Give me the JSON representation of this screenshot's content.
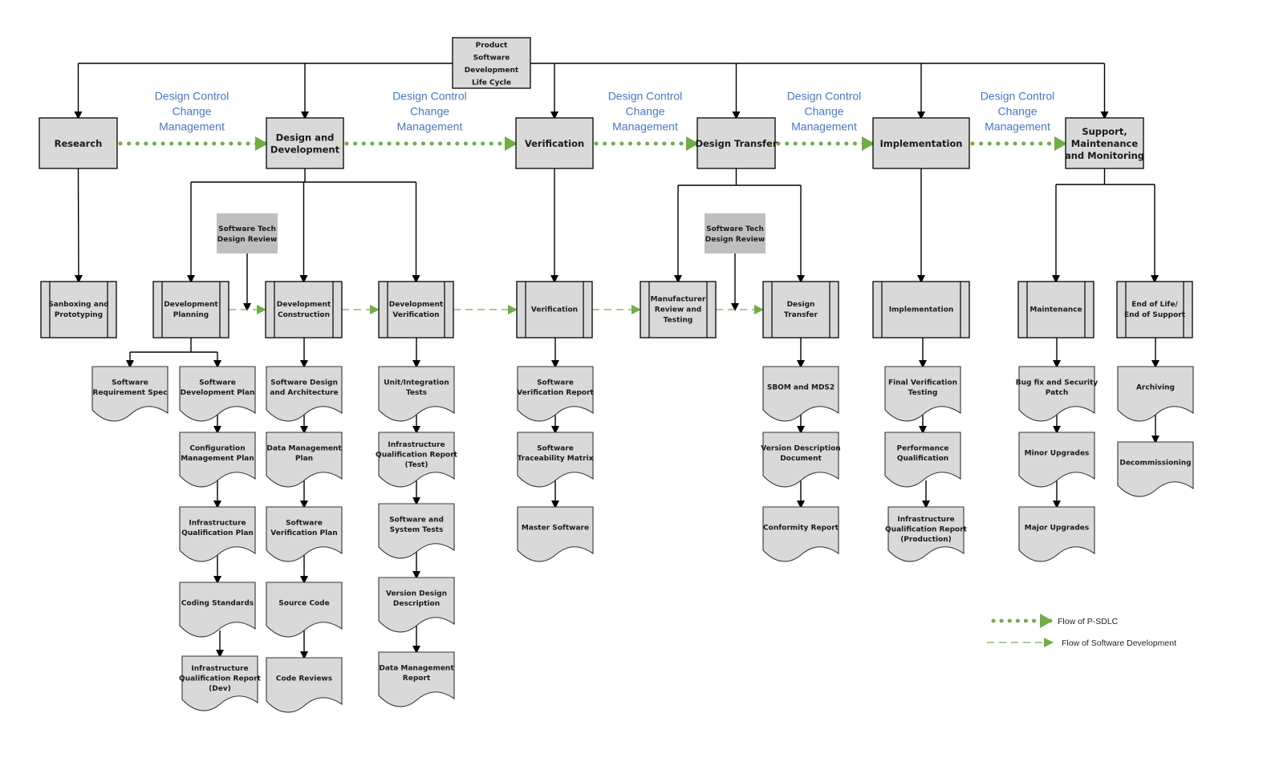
{
  "title": "Product Software Development Life Cycle",
  "colors": {
    "box_fill": "#d9d9d9",
    "review_fill": "#bfbfbf",
    "flow_green": "#70ad47",
    "annotation_blue": "#4a76c8",
    "line": "#000000"
  },
  "root": {
    "id": "root",
    "lines": [
      "Product",
      "Software",
      "Development",
      "Life Cycle"
    ]
  },
  "phases": [
    {
      "id": "research",
      "lines": [
        "Research"
      ]
    },
    {
      "id": "design-dev",
      "lines": [
        "Design and",
        "Development"
      ]
    },
    {
      "id": "verification",
      "lines": [
        "Verification"
      ]
    },
    {
      "id": "design-transfer",
      "lines": [
        "Design Transfer"
      ]
    },
    {
      "id": "implementation",
      "lines": [
        "Implementation"
      ]
    },
    {
      "id": "support",
      "lines": [
        "Support,",
        "Maintenance",
        "and Monitoring"
      ]
    }
  ],
  "phase_transition_label": [
    "Design Control",
    "Change",
    "Management"
  ],
  "review_boxes": [
    {
      "id": "review-1",
      "lines": [
        "Software Tech",
        "Design Review"
      ]
    },
    {
      "id": "review-2",
      "lines": [
        "Software Tech",
        "Design Review"
      ]
    }
  ],
  "subprocesses": [
    {
      "id": "sandboxing",
      "lines": [
        "Sanboxing and",
        "Prototyping"
      ]
    },
    {
      "id": "dev-planning",
      "lines": [
        "Development",
        "Planning"
      ]
    },
    {
      "id": "dev-construction",
      "lines": [
        "Development",
        "Construction"
      ]
    },
    {
      "id": "dev-verification",
      "lines": [
        "Development",
        "Verification"
      ]
    },
    {
      "id": "verification-sub",
      "lines": [
        "Verification"
      ]
    },
    {
      "id": "manufacturer-review",
      "lines": [
        "Manufacturer",
        "Review and",
        "Testing"
      ]
    },
    {
      "id": "design-transfer-sub",
      "lines": [
        "Design",
        "Transfer"
      ]
    },
    {
      "id": "implementation-sub",
      "lines": [
        "Implementation"
      ]
    },
    {
      "id": "maintenance",
      "lines": [
        "Maintenance"
      ]
    },
    {
      "id": "end-of-life",
      "lines": [
        "End of Life/",
        "End of Support"
      ]
    }
  ],
  "documents": [
    {
      "id": "srs",
      "lines": [
        "Software",
        "Requirement Spec"
      ]
    },
    {
      "id": "sdp",
      "lines": [
        "Software",
        "Development Plan"
      ]
    },
    {
      "id": "cmp",
      "lines": [
        "Configuration",
        "Management Plan"
      ]
    },
    {
      "id": "iqp",
      "lines": [
        "Infrastructure",
        "Qualification Plan"
      ]
    },
    {
      "id": "coding-standards",
      "lines": [
        "Coding Standards"
      ]
    },
    {
      "id": "iqr-dev",
      "lines": [
        "Infrastructure",
        "Qualification Report",
        "(Dev)"
      ]
    },
    {
      "id": "sda",
      "lines": [
        "Software Design",
        "and Architecture"
      ]
    },
    {
      "id": "dmp",
      "lines": [
        "Data Management",
        "Plan"
      ]
    },
    {
      "id": "svp",
      "lines": [
        "Software",
        "Verification Plan"
      ]
    },
    {
      "id": "source-code",
      "lines": [
        "Source Code"
      ]
    },
    {
      "id": "code-reviews",
      "lines": [
        "Code Reviews"
      ]
    },
    {
      "id": "unit-tests",
      "lines": [
        "Unit/Integration",
        "Tests"
      ]
    },
    {
      "id": "iqr-test",
      "lines": [
        "Infrastructure",
        "Qualification Report",
        "(Test)"
      ]
    },
    {
      "id": "system-tests",
      "lines": [
        "Software and",
        "System Tests"
      ]
    },
    {
      "id": "vdd-design",
      "lines": [
        "Version Design",
        "Description"
      ]
    },
    {
      "id": "dmr",
      "lines": [
        "Data Management",
        "Report"
      ]
    },
    {
      "id": "svr",
      "lines": [
        "Software",
        "Verification Report"
      ]
    },
    {
      "id": "stm",
      "lines": [
        "Software",
        "Traceability Matrix"
      ]
    },
    {
      "id": "master-software",
      "lines": [
        "Master Software"
      ]
    },
    {
      "id": "sbom",
      "lines": [
        "SBOM and MDS2"
      ]
    },
    {
      "id": "vdd",
      "lines": [
        "Version Description",
        "Document"
      ]
    },
    {
      "id": "conformity",
      "lines": [
        "Conformity Report"
      ]
    },
    {
      "id": "fvt",
      "lines": [
        "Final Verification",
        "Testing"
      ]
    },
    {
      "id": "pq",
      "lines": [
        "Performance",
        "Qualification"
      ]
    },
    {
      "id": "iqr-prod",
      "lines": [
        "Infrastructure",
        "Qualification Report",
        "(Production)"
      ]
    },
    {
      "id": "bugfix",
      "lines": [
        "Bug fix and Security",
        "Patch"
      ]
    },
    {
      "id": "minor-upgrades",
      "lines": [
        "Minor Upgrades"
      ]
    },
    {
      "id": "major-upgrades",
      "lines": [
        "Major Upgrades"
      ]
    },
    {
      "id": "archiving",
      "lines": [
        "Archiving"
      ]
    },
    {
      "id": "decommissioning",
      "lines": [
        "Decommissioning"
      ]
    }
  ],
  "legend": [
    {
      "id": "psdlc",
      "style": "dotted",
      "label": "Flow of P-SDLC"
    },
    {
      "id": "swdev",
      "style": "dashed",
      "label": "Flow of Software Development"
    }
  ]
}
